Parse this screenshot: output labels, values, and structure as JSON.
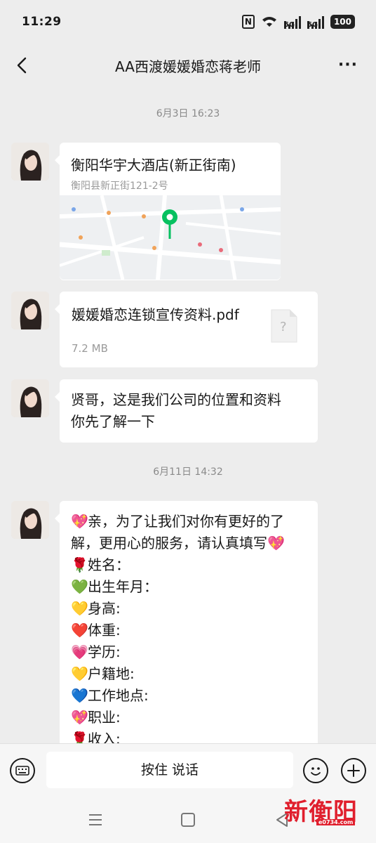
{
  "status_bar": {
    "time": "11:29",
    "network_1": "5G",
    "network_2": "5G",
    "battery": "100",
    "icons": [
      "nfc-icon",
      "wifi-icon",
      "signal-icon",
      "battery-icon"
    ]
  },
  "header": {
    "title": "AA西渡媛媛婚恋蒋老师",
    "more": "···"
  },
  "chat": {
    "timestamps": [
      "6月3日 16:23",
      "6月11日 14:32"
    ],
    "location": {
      "title": "衡阳华宇大酒店(新正街南)",
      "address": "衡阳县新正街121-2号"
    },
    "file": {
      "name": "媛媛婚恋连锁宣传资料.pdf",
      "size": "7.2 MB",
      "placeholder": "?"
    },
    "message_1": {
      "line_1": "贤哥，这是我们公司的位置和资料",
      "line_2": "你先了解一下"
    },
    "message_2": {
      "intro_line_1": "亲，为了让我们对你有更好的了",
      "intro_line_2": "解，更用心的服务，请认真填写",
      "fields": [
        {
          "emoji": "🌹",
          "label": "姓名："
        },
        {
          "emoji": "💚",
          "label": "出生年月："
        },
        {
          "emoji": "💛",
          "label": "身高:"
        },
        {
          "emoji": "❤️",
          "label": "体重:"
        },
        {
          "emoji": "💗",
          "label": "学历:"
        },
        {
          "emoji": "💛",
          "label": "户籍地:"
        },
        {
          "emoji": "💙",
          "label": "工作地点:"
        },
        {
          "emoji": "💖",
          "label": "职业:"
        },
        {
          "emoji": "🌹",
          "label": "收入:"
        }
      ],
      "heart_emoji": "💖"
    }
  },
  "input_bar": {
    "hold_to_talk": "按住 说话"
  },
  "watermark": {
    "logo_text": "新衡阳",
    "domain": "e0734.com"
  },
  "colors": {
    "background": "#ededed",
    "bubble": "#ffffff",
    "timestamp": "#8a8a8a",
    "pin": "#07c160",
    "watermark": "#e01f2d"
  }
}
